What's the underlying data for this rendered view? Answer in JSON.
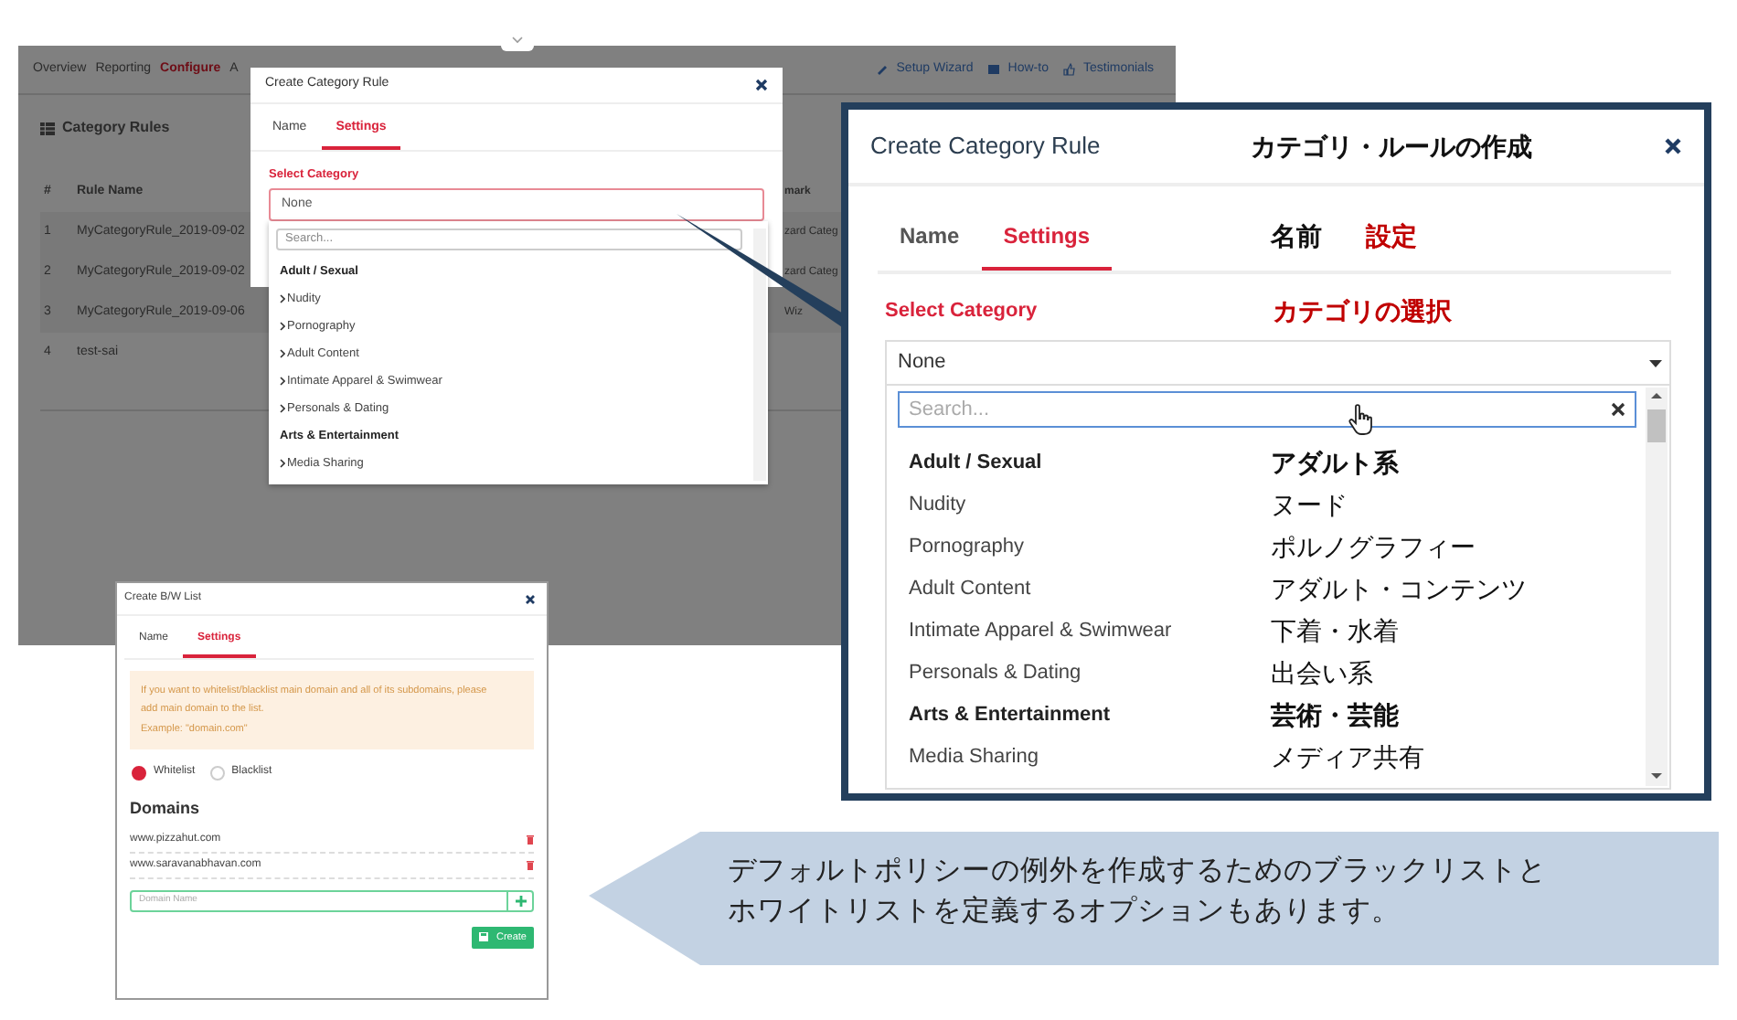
{
  "app_screen": {
    "nav": [
      {
        "label": "Overview",
        "selected": false
      },
      {
        "label": "Reporting",
        "selected": false
      },
      {
        "label": "Configure",
        "selected": true
      },
      {
        "label": "A",
        "selected": false
      }
    ],
    "nav_links": [
      {
        "label": "Setup Wizard",
        "kind": "wizard"
      },
      {
        "label": "How-to",
        "kind": "howto"
      },
      {
        "label": "Testimonials",
        "kind": "testimonials"
      }
    ],
    "card_title": "Category Rules",
    "table": {
      "columns": [
        "#",
        "Rule Name",
        "mark"
      ],
      "rows": [
        [
          "1",
          "MyCategoryRule_2019-09-02",
          "zard Categ"
        ],
        [
          "2",
          "MyCategoryRule_2019-09-02",
          "zard Categ"
        ],
        [
          "3",
          "MyCategoryRule_2019-09-06",
          "Wiz"
        ],
        [
          "4",
          "test-sai",
          ""
        ]
      ]
    }
  },
  "category_dialog": {
    "title": "Create Category Rule",
    "tabs": [
      {
        "label": "Name",
        "selected": false
      },
      {
        "label": "Settings",
        "selected": true
      }
    ],
    "field_label": "Select Category",
    "select_value": "None",
    "search_placeholder": "Search...",
    "options": [
      {
        "label": "Adult / Sexual",
        "kind": "group"
      },
      {
        "label": "Nudity",
        "kind": "item"
      },
      {
        "label": "Pornography",
        "kind": "item"
      },
      {
        "label": "Adult Content",
        "kind": "item"
      },
      {
        "label": "Intimate Apparel & Swimwear",
        "kind": "item"
      },
      {
        "label": "Personals & Dating",
        "kind": "item"
      },
      {
        "label": "Arts & Entertainment",
        "kind": "group"
      },
      {
        "label": "Media Sharing",
        "kind": "item"
      }
    ]
  },
  "zoom_panel": {
    "title": "Create Category Rule",
    "title_ja": "カテゴリ・ルールの作成",
    "tabs": [
      {
        "label": "Name",
        "label_ja": "名前",
        "selected": false
      },
      {
        "label": "Settings",
        "label_ja": "設定",
        "selected": true
      }
    ],
    "field_label": "Select Category",
    "field_label_ja": "カテゴリの選択",
    "select_value": "None",
    "search_placeholder": "Search...",
    "options": [
      {
        "label": "Adult / Sexual",
        "label_ja": "アダルト系",
        "kind": "group"
      },
      {
        "label": "Nudity",
        "label_ja": "ヌード",
        "kind": "item"
      },
      {
        "label": "Pornography",
        "label_ja": "ポルノグラフィー",
        "kind": "item"
      },
      {
        "label": "Adult Content",
        "label_ja": "アダルト・コンテンツ",
        "kind": "item"
      },
      {
        "label": "Intimate Apparel & Swimwear",
        "label_ja": "下着・水着",
        "kind": "item"
      },
      {
        "label": "Personals & Dating",
        "label_ja": "出会い系",
        "kind": "item"
      },
      {
        "label": "Arts & Entertainment",
        "label_ja": "芸術・芸能",
        "kind": "group"
      },
      {
        "label": "Media Sharing",
        "label_ja": "メディア共有",
        "kind": "item"
      }
    ]
  },
  "bw_dialog": {
    "title": "Create B/W List",
    "tabs": [
      {
        "label": "Name",
        "selected": false
      },
      {
        "label": "Settings",
        "selected": true
      }
    ],
    "notice_lines": [
      "If you want to whitelist/blacklist main domain and all of its subdomains, please",
      "add main domain to the list.",
      "Example: \"domain.com\""
    ],
    "radios": [
      {
        "label": "Whitelist",
        "selected": true
      },
      {
        "label": "Blacklist",
        "selected": false
      }
    ],
    "domains_heading": "Domains",
    "domains": [
      "www.pizzahut.com",
      "www.saravanabhavan.com"
    ],
    "input_placeholder": "Domain Name",
    "create_button": "Create"
  },
  "callout": {
    "lines": [
      "デフォルトポリシーの例外を作成するためのブラックリストと",
      "ホワイトリストを定義するオプションもあります。"
    ]
  }
}
